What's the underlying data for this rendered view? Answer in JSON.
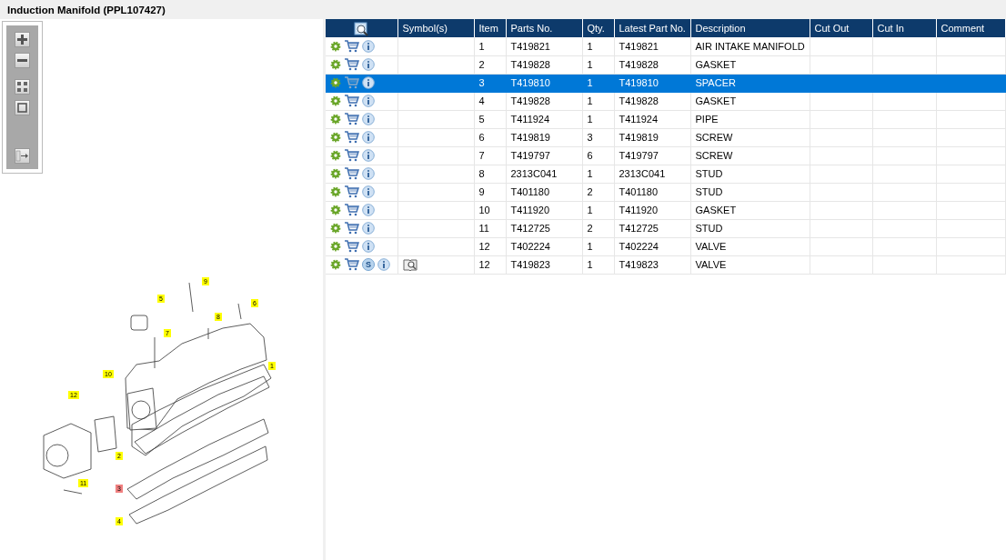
{
  "window": {
    "title": "Induction Manifold (PPL107427)"
  },
  "toolbar": {
    "buttons": [
      {
        "kind": "zoom-in"
      },
      {
        "kind": "zoom-out"
      },
      {
        "kind": "fit"
      },
      {
        "kind": "actual"
      },
      {
        "kind": "export"
      }
    ]
  },
  "diagram": {
    "callouts": [
      {
        "label": "5",
        "selected": false
      },
      {
        "label": "9",
        "selected": false
      },
      {
        "label": "6",
        "selected": false
      },
      {
        "label": "8",
        "selected": false
      },
      {
        "label": "7",
        "selected": false
      },
      {
        "label": "1",
        "selected": false
      },
      {
        "label": "10",
        "selected": false
      },
      {
        "label": "12",
        "selected": false
      },
      {
        "label": "2",
        "selected": false
      },
      {
        "label": "11",
        "selected": false
      },
      {
        "label": "3",
        "selected": true
      },
      {
        "label": "4",
        "selected": false
      }
    ]
  },
  "table": {
    "columns": [
      "",
      "Symbol(s)",
      "Item",
      "Parts No.",
      "Qty.",
      "Latest Part No.",
      "Description",
      "Cut Out",
      "Cut In",
      "Comment"
    ],
    "rows": [
      {
        "item": "1",
        "part_no": "T419821",
        "qty": "1",
        "latest": "T419821",
        "description": "AIR INTAKE MANIFOLD",
        "selected": false,
        "has_symbol": false
      },
      {
        "item": "2",
        "part_no": "T419828",
        "qty": "1",
        "latest": "T419828",
        "description": "GASKET",
        "selected": false,
        "has_symbol": false
      },
      {
        "item": "3",
        "part_no": "T419810",
        "qty": "1",
        "latest": "T419810",
        "description": "SPACER",
        "selected": true,
        "has_symbol": false
      },
      {
        "item": "4",
        "part_no": "T419828",
        "qty": "1",
        "latest": "T419828",
        "description": "GASKET",
        "selected": false,
        "has_symbol": false
      },
      {
        "item": "5",
        "part_no": "T411924",
        "qty": "1",
        "latest": "T411924",
        "description": "PIPE",
        "selected": false,
        "has_symbol": false
      },
      {
        "item": "6",
        "part_no": "T419819",
        "qty": "3",
        "latest": "T419819",
        "description": "SCREW",
        "selected": false,
        "has_symbol": false
      },
      {
        "item": "7",
        "part_no": "T419797",
        "qty": "6",
        "latest": "T419797",
        "description": "SCREW",
        "selected": false,
        "has_symbol": false
      },
      {
        "item": "8",
        "part_no": "2313C041",
        "qty": "1",
        "latest": "2313C041",
        "description": "STUD",
        "selected": false,
        "has_symbol": false
      },
      {
        "item": "9",
        "part_no": "T401180",
        "qty": "2",
        "latest": "T401180",
        "description": "STUD",
        "selected": false,
        "has_symbol": false
      },
      {
        "item": "10",
        "part_no": "T411920",
        "qty": "1",
        "latest": "T411920",
        "description": "GASKET",
        "selected": false,
        "has_symbol": false
      },
      {
        "item": "11",
        "part_no": "T412725",
        "qty": "2",
        "latest": "T412725",
        "description": "STUD",
        "selected": false,
        "has_symbol": false
      },
      {
        "item": "12",
        "part_no": "T402224",
        "qty": "1",
        "latest": "T402224",
        "description": "VALVE",
        "selected": false,
        "has_symbol": false
      },
      {
        "item": "12",
        "part_no": "T419823",
        "qty": "1",
        "latest": "T419823",
        "description": "VALVE",
        "selected": false,
        "has_symbol": true,
        "badge": "S"
      }
    ]
  }
}
